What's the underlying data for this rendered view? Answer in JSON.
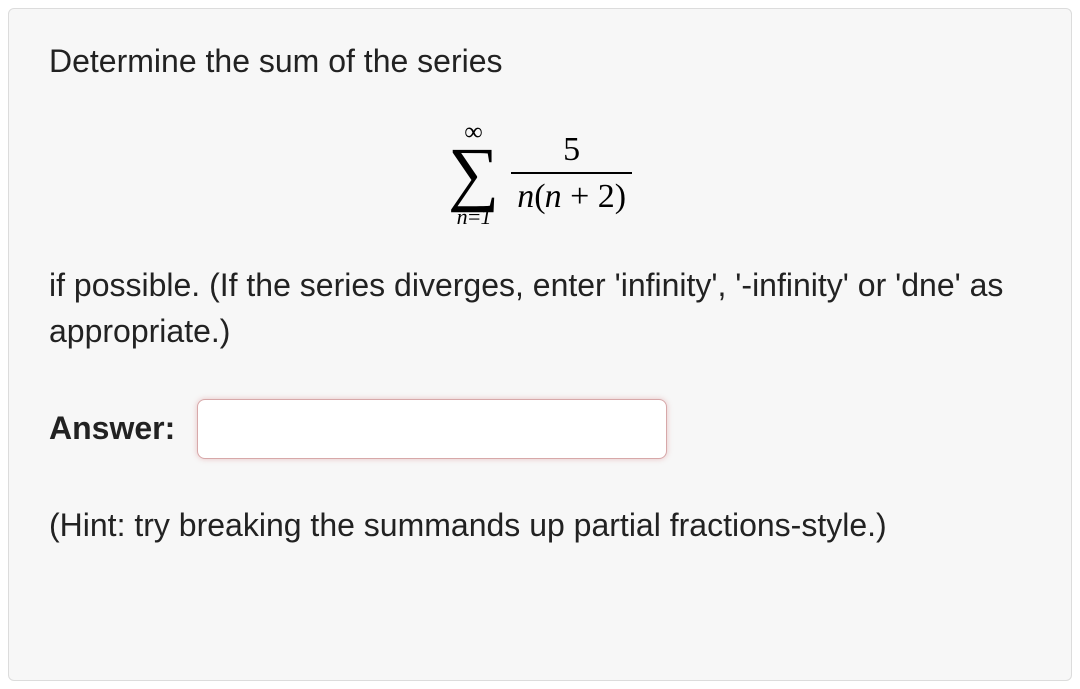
{
  "question": {
    "prompt_top": "Determine the sum of the series",
    "prompt_bottom": "if possible. (If the series diverges, enter 'infinity', '-infinity' or 'dne' as appropriate.)",
    "answer_label": "Answer:",
    "answer_value": "",
    "hint": "(Hint: try breaking the summands up partial fractions-style.)"
  },
  "math": {
    "upper_limit": "∞",
    "lower_limit": "n=1",
    "numerator": "5",
    "denominator_n1": "n",
    "denominator_paren_open": "(",
    "denominator_n2": "n",
    "denominator_plus": " + ",
    "denominator_two": "2",
    "denominator_paren_close": ")"
  }
}
